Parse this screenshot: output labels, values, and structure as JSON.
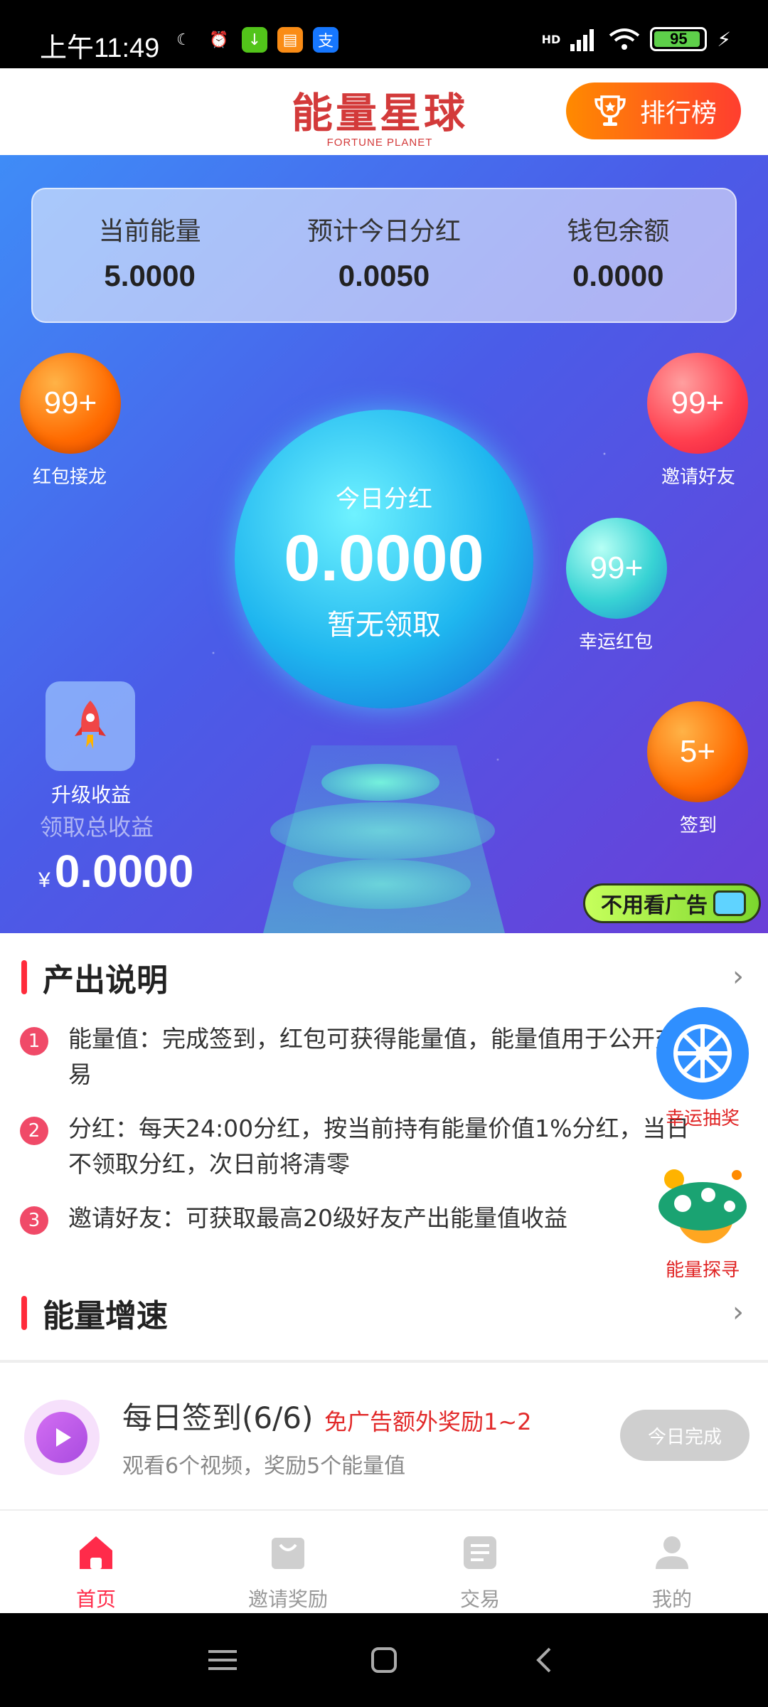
{
  "status_bar": {
    "time": "上午11:49",
    "battery": "95",
    "network": "HD"
  },
  "header": {
    "logo_cn": "能量星球",
    "logo_en": "FORTUNE PLANET",
    "rank_label": "排行榜"
  },
  "stats": [
    {
      "label": "当前能量",
      "value": "5.0000"
    },
    {
      "label": "预计今日分红",
      "value": "0.0050"
    },
    {
      "label": "钱包余额",
      "value": "0.0000"
    }
  ],
  "bubbles": {
    "red_packet_relay": {
      "count": "99+",
      "label": "红包接龙"
    },
    "invite_friends": {
      "count": "99+",
      "label": "邀请好友"
    },
    "lucky_red_packet": {
      "count": "99+",
      "label": "幸运红包"
    },
    "sign_in": {
      "count": "5+",
      "label": "签到"
    }
  },
  "main_ball": {
    "title": "今日分红",
    "value": "0.0000",
    "status": "暂无领取"
  },
  "upgrade_label": "升级收益",
  "total": {
    "label": "领取总收益",
    "currency": "¥",
    "value": "0.0000"
  },
  "no_ad_label": "不用看广告",
  "output_section": {
    "title": "产出说明",
    "items": [
      {
        "num": "1",
        "text": "能量值：完成签到，红包可获得能量值，能量值用于公开交易"
      },
      {
        "num": "2",
        "text": "分红：每天24:00分红，按当前持有能量价值1%分红，当日不领取分红，次日前将清零"
      },
      {
        "num": "3",
        "text": "邀请好友：可获取最高20级好友产出能量值收益"
      }
    ]
  },
  "float": {
    "lottery_label": "幸运抽奖",
    "explore_label": "能量探寻"
  },
  "speed_section": {
    "title": "能量增速"
  },
  "task": {
    "title": "每日签到(6/6)",
    "extra": "免广告额外奖励1~2",
    "desc": "观看6个视频，奖励5个能量值",
    "button": "今日完成"
  },
  "tabs": [
    {
      "label": "首页",
      "icon": "home-icon"
    },
    {
      "label": "邀请奖励",
      "icon": "bag-icon"
    },
    {
      "label": "交易",
      "icon": "list-icon"
    },
    {
      "label": "我的",
      "icon": "user-icon"
    }
  ],
  "colors": {
    "accent": "#ff2b4a",
    "rank_gradient_start": "#ff8a00",
    "rank_gradient_end": "#ff3e2f",
    "hero_start": "#3f8cf7",
    "hero_end": "#6a3fd8"
  }
}
